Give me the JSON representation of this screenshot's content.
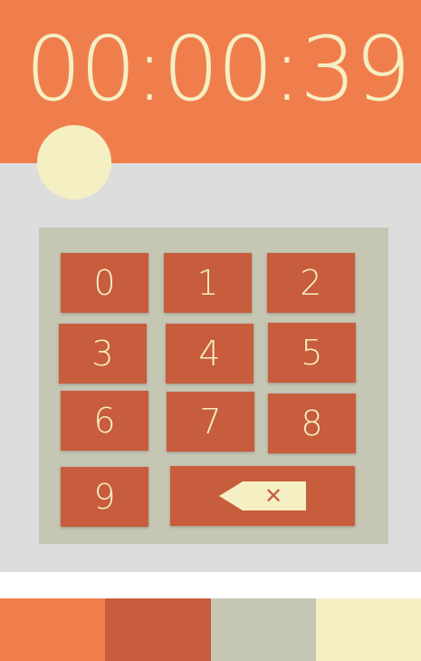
{
  "timer": {
    "display": "00:00:39"
  },
  "keypad": {
    "keys": [
      "0",
      "1",
      "2",
      "3",
      "4",
      "5",
      "6",
      "7",
      "8",
      "9"
    ],
    "backspace_icon": "backspace-icon",
    "backspace_symbol": "✕"
  },
  "palette": {
    "swatches": [
      {
        "name": "orange",
        "color": "#f07e4c"
      },
      {
        "name": "rust",
        "color": "#c75d3c"
      },
      {
        "name": "gray-beige",
        "color": "#c6c6b4"
      },
      {
        "name": "cream",
        "color": "#f5efc4"
      }
    ]
  },
  "colors": {
    "primary": "#f07e4c",
    "key": "#c75d3c",
    "pad": "#c6c6b4",
    "accent": "#f5efc4",
    "background": "#dddddd"
  }
}
